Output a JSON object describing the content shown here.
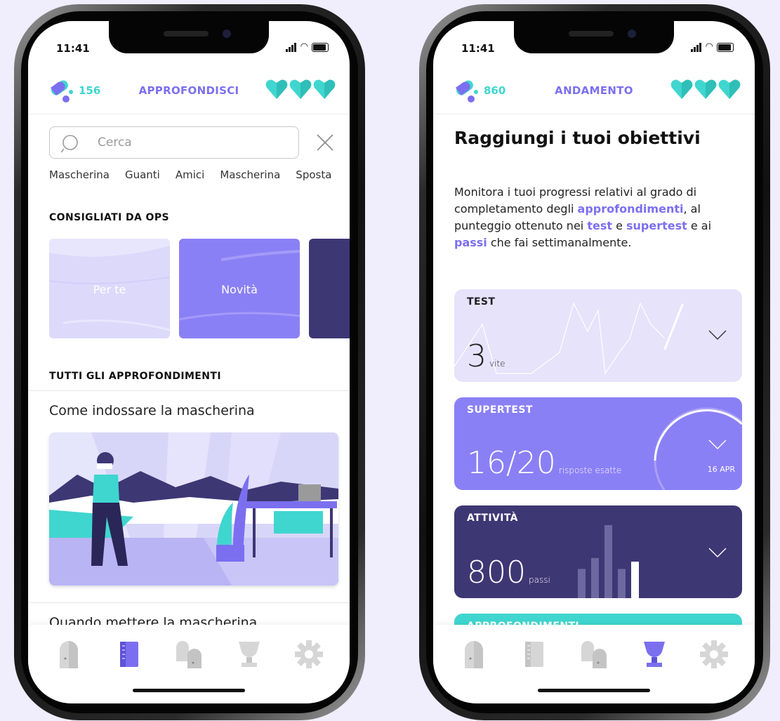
{
  "colors": {
    "accent": "#7b6ff0",
    "teal": "#3fd6cf",
    "navy": "#3d3774",
    "lavender": "#e6e3fb",
    "periwinkle": "#8a80f5",
    "background": "#f0edfc"
  },
  "left": {
    "status": {
      "time": "11:41"
    },
    "header": {
      "coins": "156",
      "title": "APPROFONDISCI",
      "hearts": 3
    },
    "search": {
      "placeholder": "Cerca"
    },
    "chips": [
      "Mascherina",
      "Guanti",
      "Amici",
      "Mascherina",
      "Sposta"
    ],
    "recommended": {
      "title": "CONSIGLIATI DA OPS",
      "cards": [
        {
          "label": "Per te"
        },
        {
          "label": "Novità"
        },
        {
          "label": ""
        }
      ]
    },
    "all": {
      "title": "TUTTI GLI APPROFONDIMENTI",
      "articles": [
        {
          "title": "Come indossare la mascherina"
        },
        {
          "title": "Quando mettere la mascherina"
        }
      ]
    },
    "tabbar": {
      "icons": [
        "door-icon",
        "book-icon",
        "doors-icon",
        "trophy-icon",
        "gear-icon"
      ],
      "active": 1
    }
  },
  "right": {
    "status": {
      "time": "11:41"
    },
    "header": {
      "coins": "860",
      "title": "ANDAMENTO",
      "hearts": 3
    },
    "heading": "Raggiungi i tuoi obiettivi",
    "desc": {
      "p1": "Monitora i tuoi progressi relativi al grado di completamento degli ",
      "h1": "approfondimenti",
      "p2": ", al punteggio ottenuto nei ",
      "h2": "test",
      "p3": " e ",
      "h3": "supertest",
      "p4": " e ai ",
      "h4": "passi",
      "p5": " che fai settimanalmente."
    },
    "cards": {
      "test": {
        "title": "TEST",
        "value": "3",
        "unit": "vite"
      },
      "supertest": {
        "title": "SUPERTEST",
        "value": "16/20",
        "unit": "risposte esatte",
        "date": "16 APR",
        "progress": 0.35
      },
      "activity": {
        "title": "ATTIVITÀ",
        "value": "800",
        "unit": "passi",
        "bars": [
          0.4,
          0.55,
          1.0,
          0.4,
          0.5
        ]
      },
      "approfondimenti": {
        "title": "APPROFONDIMENTI"
      }
    },
    "tabbar": {
      "icons": [
        "door-icon",
        "book-icon",
        "doors-icon",
        "trophy-icon",
        "gear-icon"
      ],
      "active": 3
    }
  }
}
